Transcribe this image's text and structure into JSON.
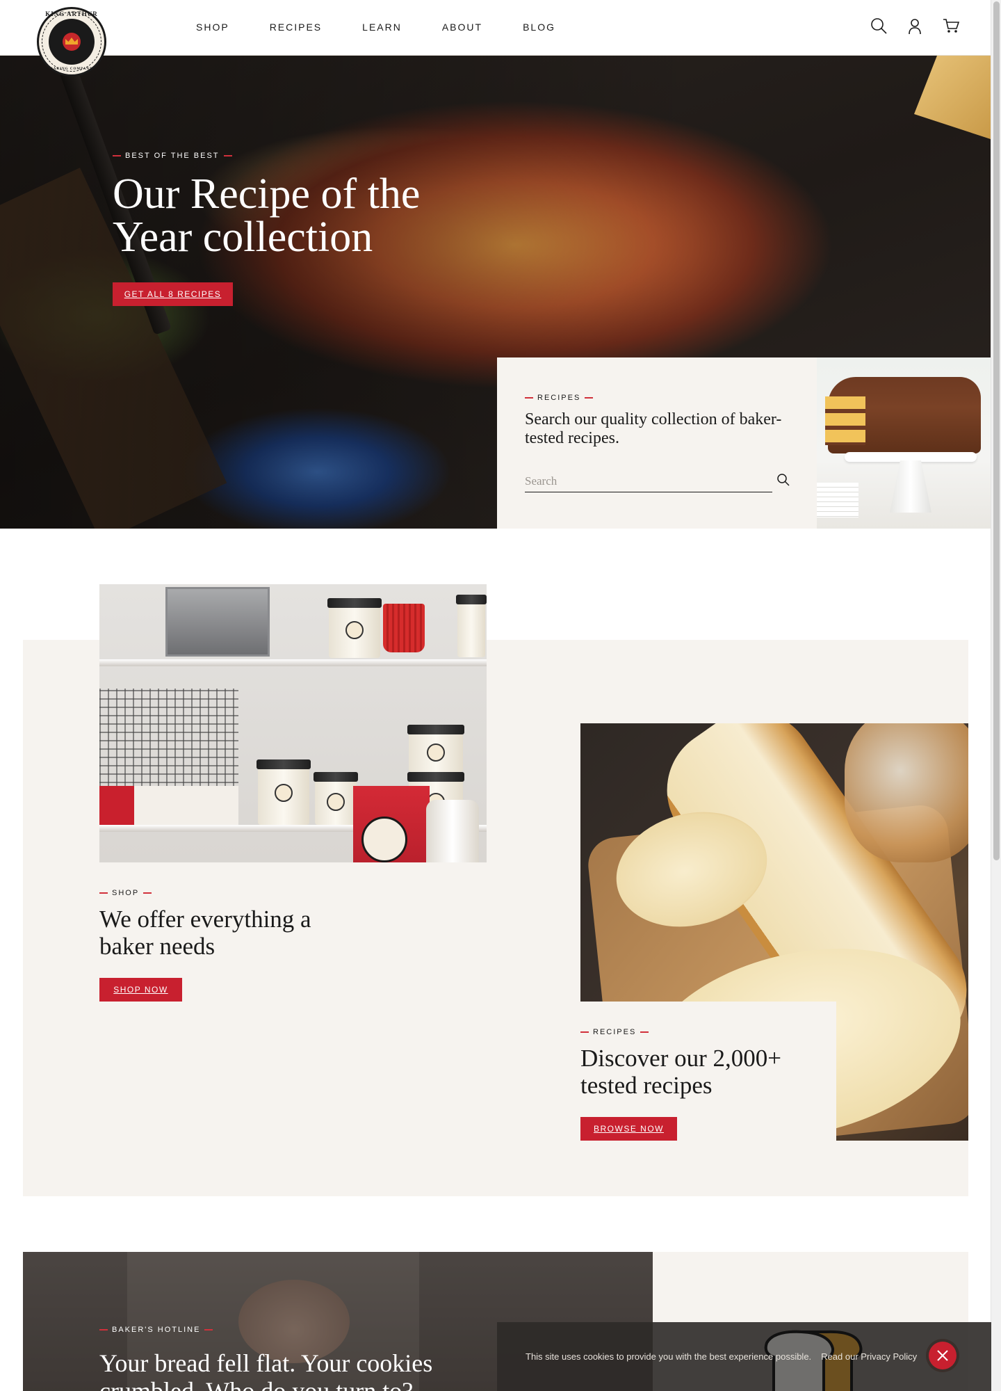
{
  "header": {
    "logo_top": "KING ARTHUR",
    "logo_bottom": "BAKING COMPANY",
    "nav": [
      "SHOP",
      "RECIPES",
      "LEARN",
      "ABOUT",
      "BLOG"
    ],
    "icons": [
      "search-icon",
      "account-icon",
      "cart-icon"
    ]
  },
  "hero": {
    "eyebrow": "BEST OF THE BEST",
    "title": "Our Recipe of the Year collection",
    "button": "GET ALL 8 RECIPES"
  },
  "search_card": {
    "eyebrow": "RECIPES",
    "heading": "Search our quality collection of baker-tested recipes.",
    "placeholder": "Search"
  },
  "shop": {
    "eyebrow": "SHOP",
    "title": "We offer everything a baker needs",
    "button": "SHOP NOW"
  },
  "recipes": {
    "eyebrow": "RECIPES",
    "title": "Discover our 2,000+ tested recipes",
    "button": "BROWSE NOW"
  },
  "hotline": {
    "eyebrow": "BAKER'S HOTLINE",
    "title": "Your bread fell flat. Your cookies crumbled. Who do you turn to?"
  },
  "cookie": {
    "text": "This site uses cookies to provide you with the best experience possible.",
    "link": "Read our Privacy Policy"
  },
  "colors": {
    "accent": "#c8202f",
    "beige": "#f6f3ef",
    "text": "#1a1a1a"
  }
}
